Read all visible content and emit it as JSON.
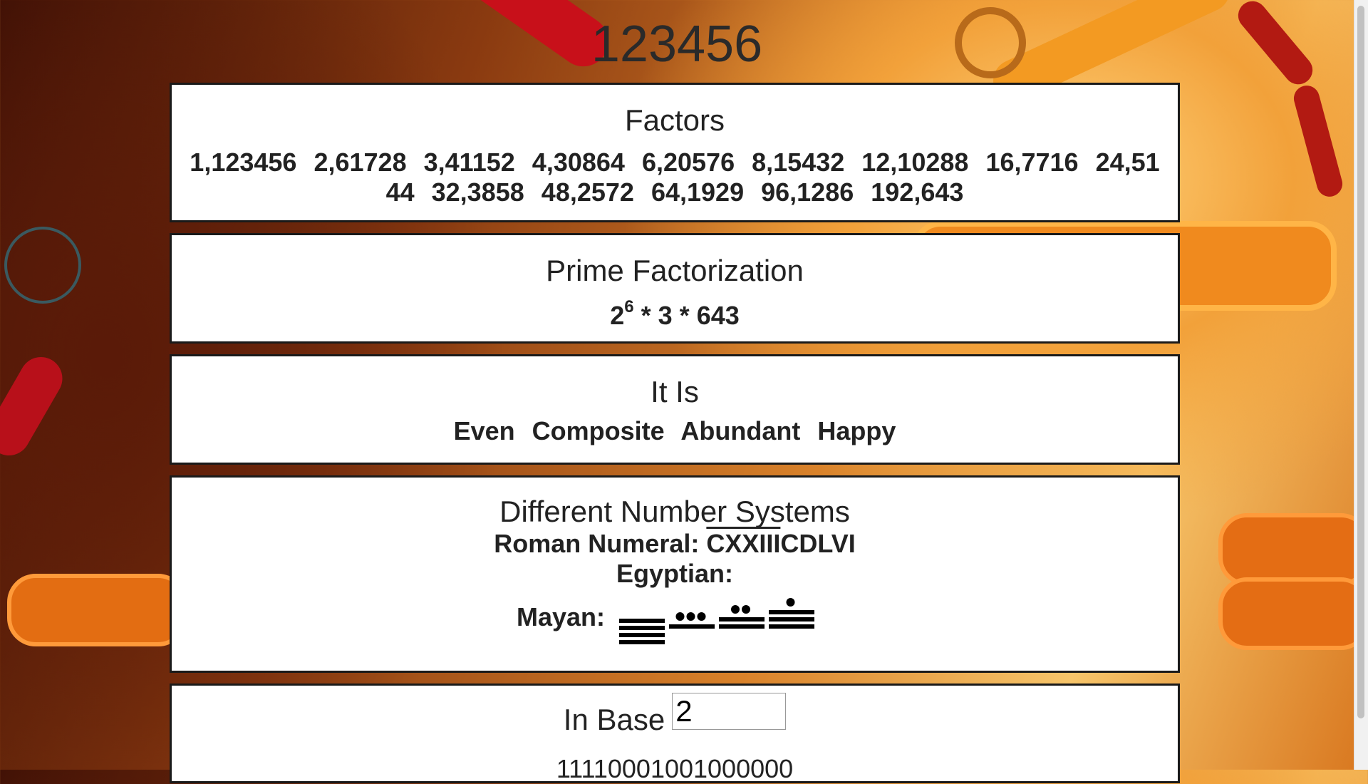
{
  "title": "123456",
  "factors": {
    "heading": "Factors",
    "pairs": [
      "1,123456",
      "2,61728",
      "3,41152",
      "4,30864",
      "6,20576",
      "8,15432",
      "12,10288",
      "16,7716",
      "24,5144",
      "32,3858",
      "48,2572",
      "64,1929",
      "96,1286",
      "192,643"
    ]
  },
  "prime_factorization": {
    "heading": "Prime Factorization",
    "base1": "2",
    "exp1": "6",
    "rest": "* 3 * 643"
  },
  "it_is": {
    "heading": "It Is",
    "properties": [
      "Even",
      "Composite",
      "Abundant",
      "Happy"
    ]
  },
  "number_systems": {
    "heading": "Different Number Systems",
    "roman_label": "Roman Numeral:",
    "roman_overlined": "CXXIII",
    "roman_rest": "CDLVI",
    "egyptian_label": "Egyptian:",
    "mayan_label": "Mayan:",
    "mayan_digits": [
      {
        "dots": 0,
        "bars": 4
      },
      {
        "dots": 3,
        "bars": 1
      },
      {
        "dots": 2,
        "bars": 2
      },
      {
        "dots": 1,
        "bars": 3
      }
    ]
  },
  "in_base": {
    "heading": "In Base",
    "base_value": "2",
    "result": "11110001001000000"
  }
}
